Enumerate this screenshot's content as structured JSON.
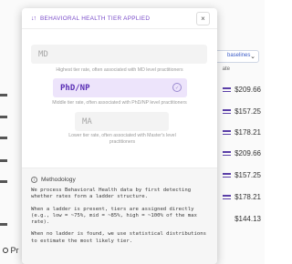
{
  "modal": {
    "title": "BEHAVIORAL HEALTH TIER APPLIED",
    "close_icon": "×",
    "tiers": [
      {
        "label": "MD",
        "caption": "Highest tier rate, often associated with MD level practitioners"
      },
      {
        "label": "PhD/NP",
        "caption": "Middle tier rate, often associated with PhD/NP level practitioners",
        "selected": true
      },
      {
        "label": "MA",
        "caption": "Lower tier rate, often associated with Master's level practitioners"
      }
    ],
    "methodology": {
      "heading": "Methodology",
      "paragraphs": [
        "We process Behavioral Health data by first detecting whether rates form a ladder structure.",
        "When a ladder is present, tiers are assigned directly (e.g., low = ~75%, mid = ~85%, high = ~100% of the max rate).",
        "When no ladder is found, we use statistical distributions to estimate the most likely tier."
      ]
    }
  },
  "background": {
    "select_value": "baselines",
    "column_header": "ate",
    "prices": [
      "$209.66",
      "$157.25",
      "$178.21",
      "$209.66",
      "$157.25",
      "$178.21",
      "$144.13"
    ],
    "bottom_left_fragment": "Pr"
  },
  "colors": {
    "accent": "#7a4cc9",
    "selected_bg": "#ede4fb"
  }
}
